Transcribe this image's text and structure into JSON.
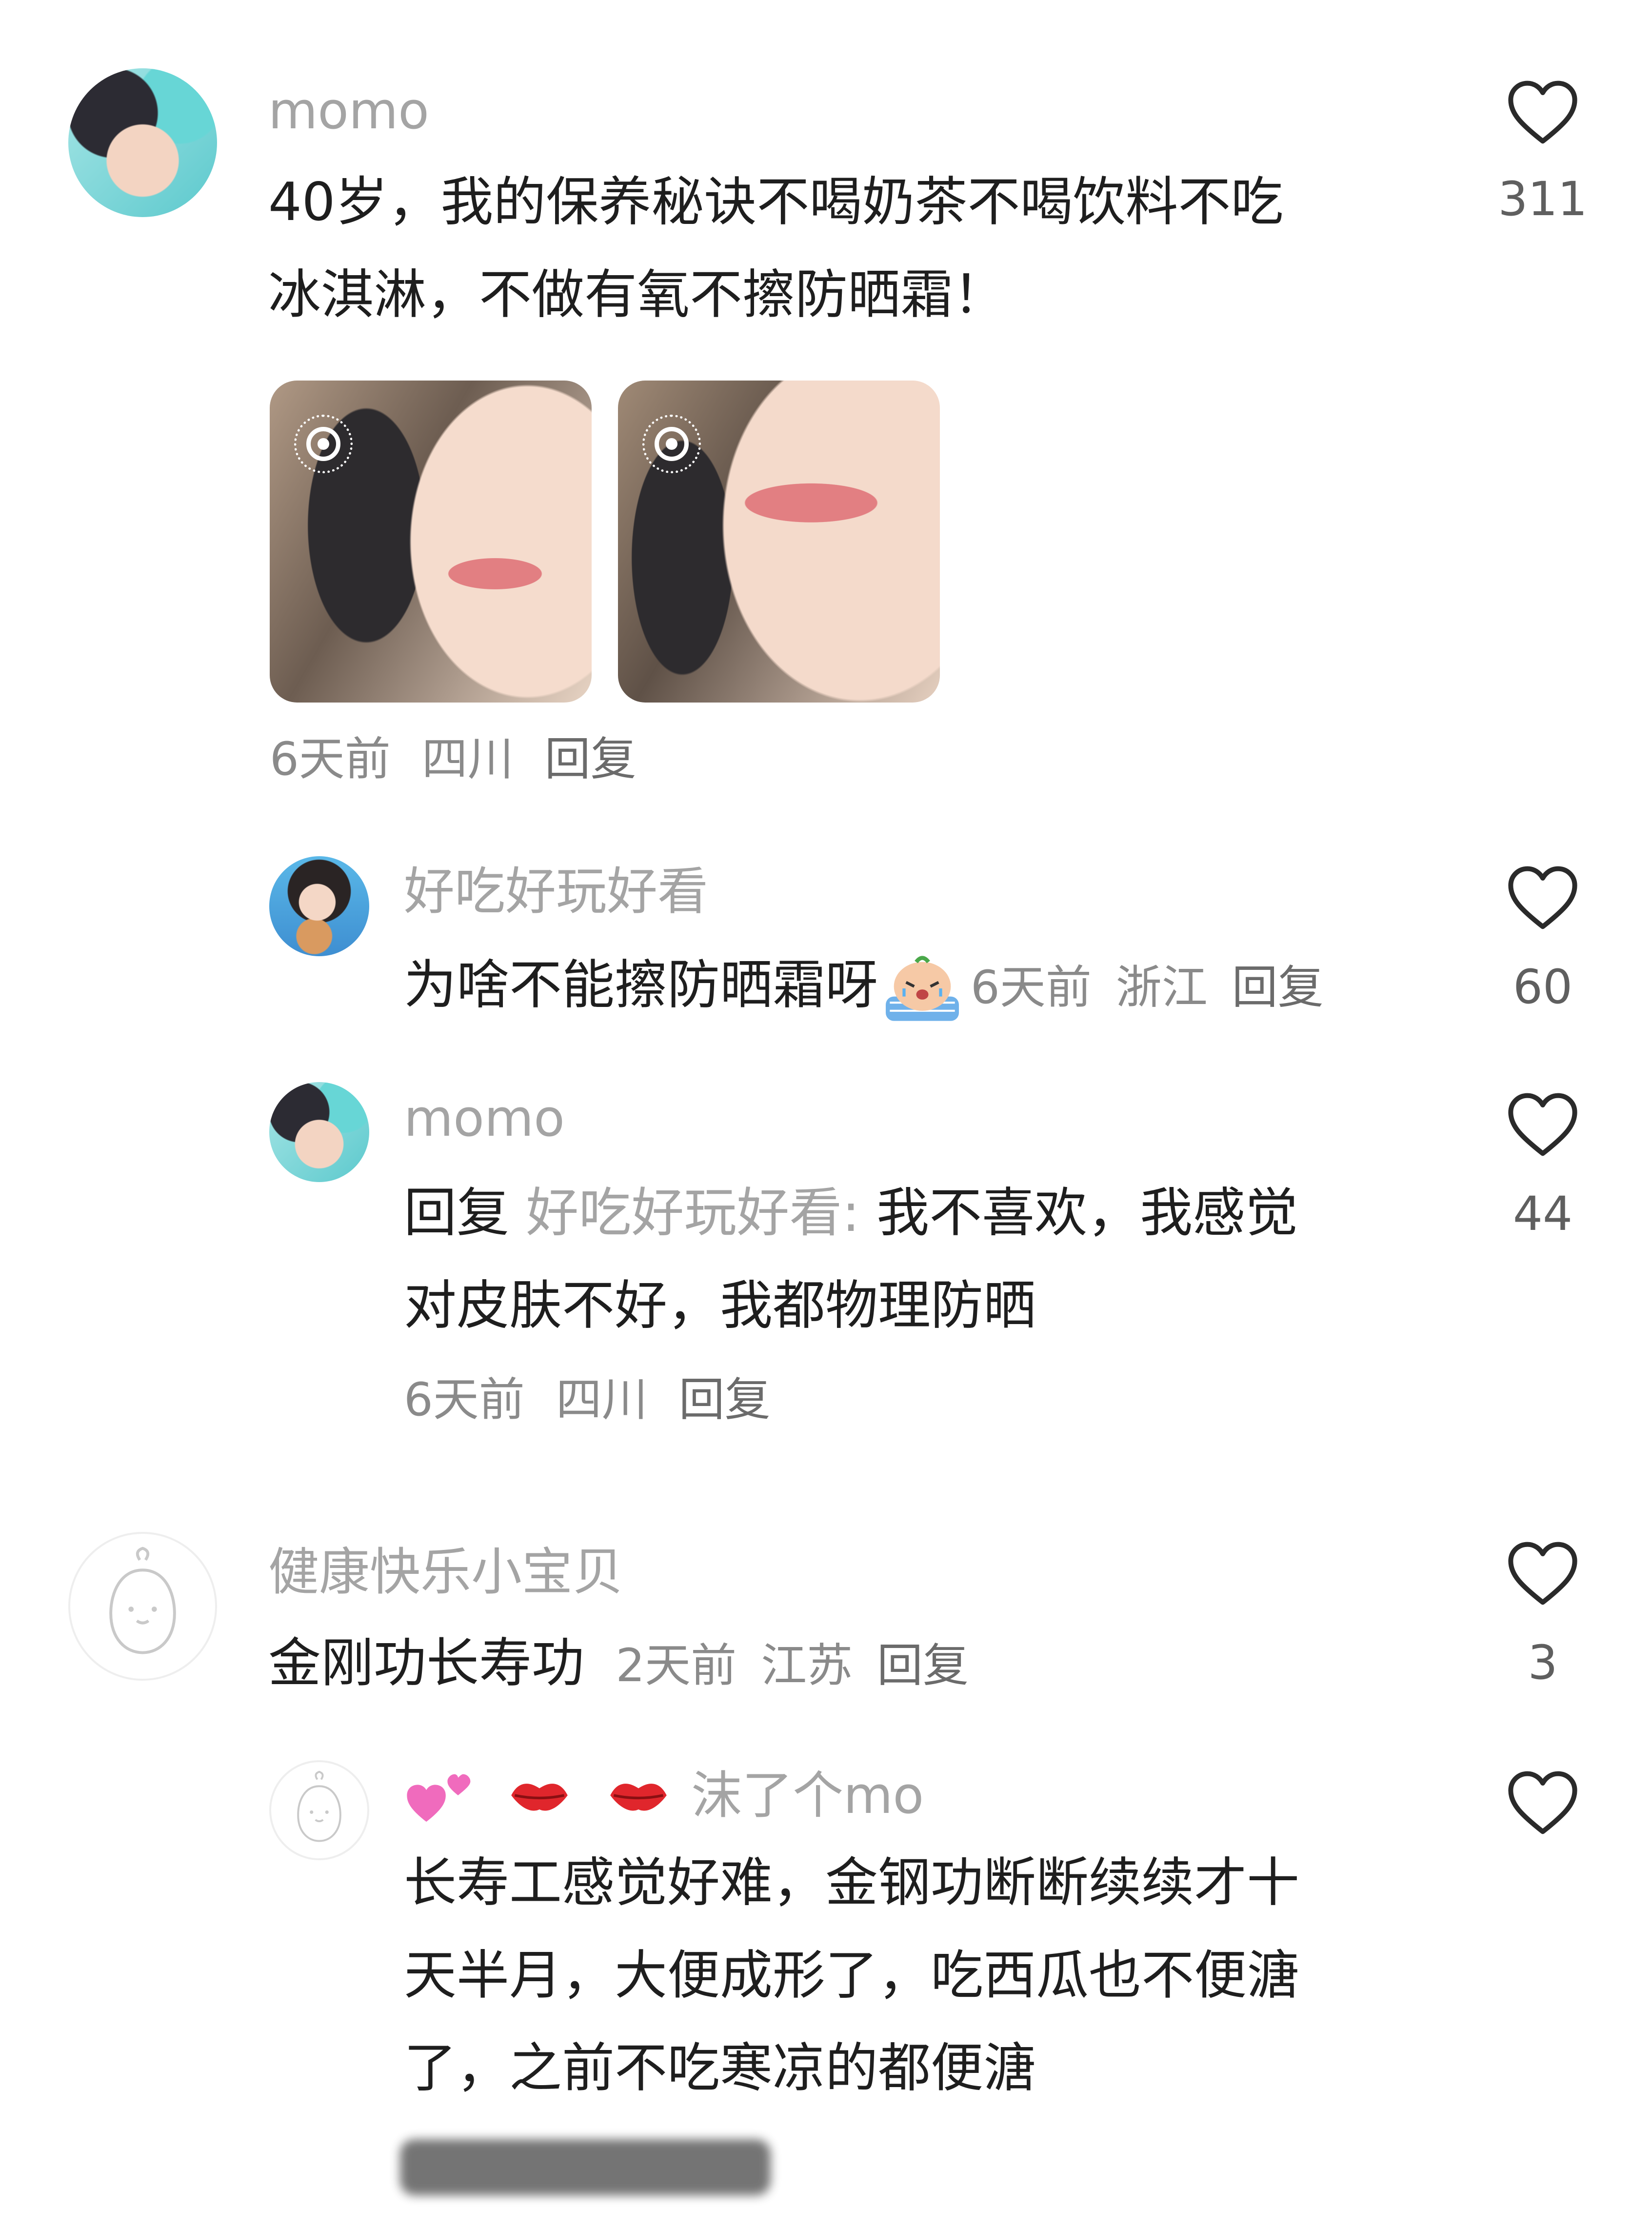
{
  "comments": [
    {
      "username": "momo",
      "text_lines": [
        "40岁，我的保养秘诀不喝奶茶不喝饮料不吃",
        "冰淇淋，不做有氧不擦防晒霜！"
      ],
      "meta": {
        "time": "6天前",
        "location": "四川",
        "reply": "回复"
      },
      "likes": "311"
    },
    {
      "username": "好吃好玩好看",
      "text": "为啥不能擦防晒霜呀",
      "meta": {
        "time": "6天前",
        "location": "浙江",
        "reply": "回复"
      },
      "likes": "60"
    },
    {
      "username": "momo",
      "reply_prefix": "回复",
      "reply_to": "好吃好玩好看:",
      "text_lines": [
        "我不喜欢，我感觉",
        "对皮肤不好，我都物理防晒"
      ],
      "meta": {
        "time": "6天前",
        "location": "四川",
        "reply": "回复"
      },
      "likes": "44"
    },
    {
      "username": "健康快乐小宝贝",
      "text": "金刚功长寿功",
      "meta": {
        "time": "2天前",
        "location": "江苏",
        "reply": "回复"
      },
      "likes": "3"
    },
    {
      "username": "沫了个mo",
      "text_lines": [
        "长寿工感觉好难，金钢功断断续续才十",
        "天半月，大便成形了，吃西瓜也不便溏",
        "了，之前不吃寒凉的都便溏"
      ],
      "likes": ""
    }
  ],
  "icons": {
    "like": "heart-outline-icon",
    "live_photo": "live-photo-icon",
    "emoji": "crying-emoji-icon",
    "name_decor": [
      "hearts-emoji-icon",
      "kiss-mark-icon",
      "kiss-mark-icon"
    ]
  },
  "colors": {
    "name": "#a4a4a4",
    "body": "#1e1e1e",
    "meta": "#8a8a8a"
  }
}
